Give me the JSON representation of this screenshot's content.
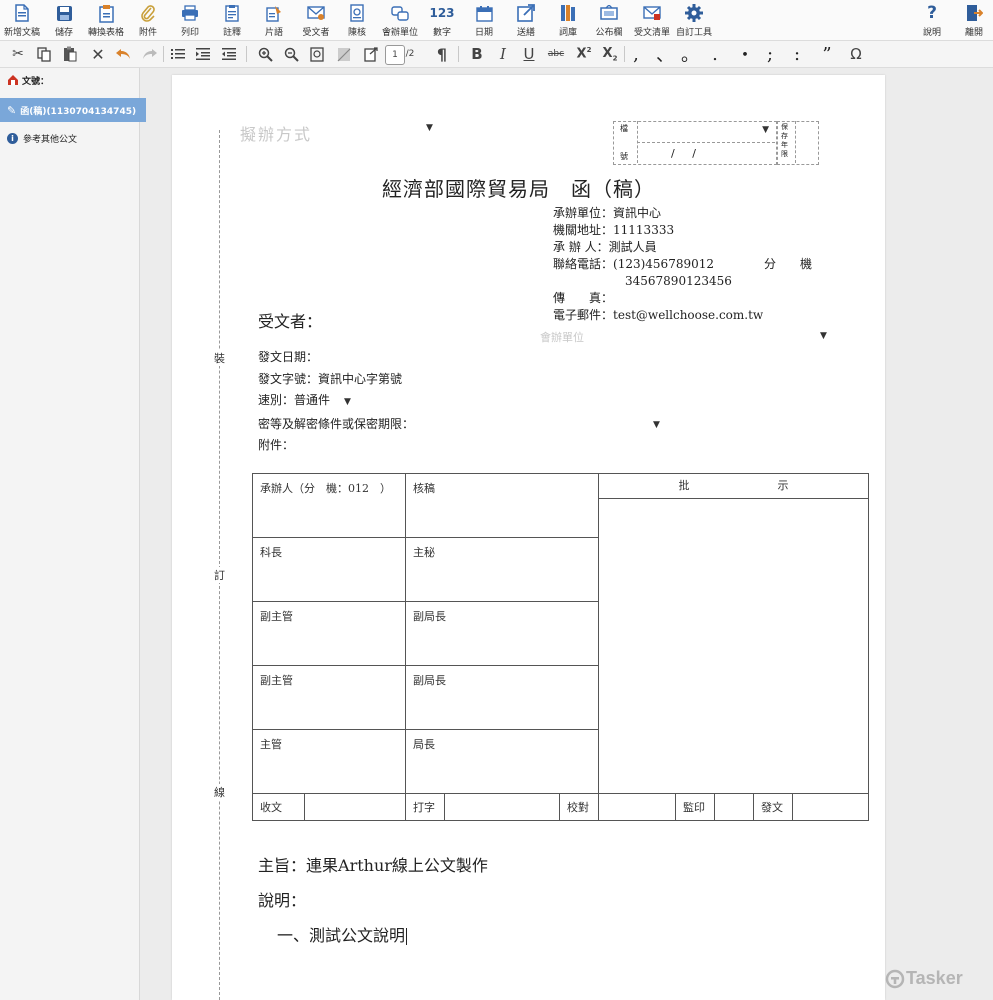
{
  "toolbar": {
    "items": [
      {
        "label": "新增文稿",
        "icon": "new-document-icon"
      },
      {
        "label": "儲存",
        "icon": "save-icon"
      },
      {
        "label": "轉換表格",
        "icon": "convert-table-icon"
      },
      {
        "label": "附件",
        "icon": "attachment-icon"
      },
      {
        "label": "列印",
        "icon": "print-icon"
      },
      {
        "label": "註釋",
        "icon": "annotation-icon"
      },
      {
        "label": "片語",
        "icon": "phrase-icon"
      },
      {
        "label": "受文者",
        "icon": "recipient-icon"
      },
      {
        "label": "陳核",
        "icon": "submit-review-icon"
      },
      {
        "label": "會辦單位",
        "icon": "co-units-icon"
      },
      {
        "label": "數字",
        "icon": "numbers-icon"
      },
      {
        "label": "日期",
        "icon": "calendar-icon"
      },
      {
        "label": "送繕",
        "icon": "send-icon"
      },
      {
        "label": "詞庫",
        "icon": "glossary-icon"
      },
      {
        "label": "公布欄",
        "icon": "bulletin-icon"
      },
      {
        "label": "受文清單",
        "icon": "recipient-list-icon"
      },
      {
        "label": "自訂工具",
        "icon": "gear-icon"
      },
      {
        "label": "說明",
        "icon": "help-icon"
      },
      {
        "label": "離開",
        "icon": "exit-icon"
      }
    ]
  },
  "format_toolbar": {
    "page_current": "1",
    "page_total": "/2",
    "numbers_icon_text": "123",
    "bold": "B",
    "italic": "I",
    "underline": "U",
    "strike": "abc",
    "superscript": "X",
    "sup_mark": "2",
    "subscript": "X",
    "sub_mark": "2",
    "pilcrow": "¶",
    "omega": "Ω",
    "punctuation": [
      ",",
      "、",
      "。",
      ".",
      "・",
      ";",
      ":",
      "”"
    ]
  },
  "sidebar": {
    "header": "文號：",
    "active_item": "函(稿)(1130704134745)",
    "other_item": "參考其他公文"
  },
  "document": {
    "draft_method_placeholder": "擬辦方式",
    "archive_label_top": "檔",
    "archive_label_bottom": "號",
    "archive_slashes": "/     /",
    "retention_label": "保存年限",
    "binding_chars": [
      "裝",
      "訂",
      "線"
    ],
    "title": "經濟部國際貿易局　函（稿）",
    "info": [
      {
        "label": "承辦單位：",
        "value": "資訊中心"
      },
      {
        "label": "機關地址：",
        "value": "11113333"
      },
      {
        "label": "承 辦 人：",
        "value": "測試人員"
      },
      {
        "label": "聯絡電話：",
        "value": "(123)456789012",
        "suffix": "分　　機"
      },
      {
        "label": "",
        "value": "34567890123456"
      },
      {
        "label": "傳　　真：",
        "value": ""
      },
      {
        "label": "電子郵件：",
        "value": "test@wellchoose.com.tw"
      }
    ],
    "co_unit_placeholder": "會辦單位",
    "recipient_label": "受文者：",
    "fields": [
      {
        "label": "發文日期：",
        "value": ""
      },
      {
        "label": "發文字號：",
        "value": "資訊中心字第號"
      },
      {
        "label": "速別：",
        "value": "普通件"
      },
      {
        "label": "密等及解密條件或保密期限：",
        "value": ""
      },
      {
        "label": "附件：",
        "value": ""
      }
    ],
    "approval_table": {
      "rows": [
        [
          "承辦人（分　機：012　）",
          "核稿"
        ],
        [
          "科長",
          "主秘"
        ],
        [
          "副主管",
          "副局長"
        ],
        [
          "副主管",
          "副局長"
        ],
        [
          "主管",
          "局長"
        ]
      ],
      "instruction_header": "批　　　　　　　　示",
      "bottom_row": [
        "收文",
        "",
        "打字",
        "",
        "校對",
        "",
        "監印",
        "",
        "發文",
        ""
      ]
    },
    "subject_label": "主旨：",
    "subject_text": "連果Arthur線上公文製作",
    "explanation_label": "說明：",
    "explanation_item": "一、測試公文說明"
  },
  "watermark": "Tasker",
  "colors": {
    "accent": "#7aa7d9",
    "icon_blue": "#3b6fb6",
    "icon_orange": "#d9822b",
    "icon_gold": "#c9a03b",
    "red": "#cc3322"
  }
}
